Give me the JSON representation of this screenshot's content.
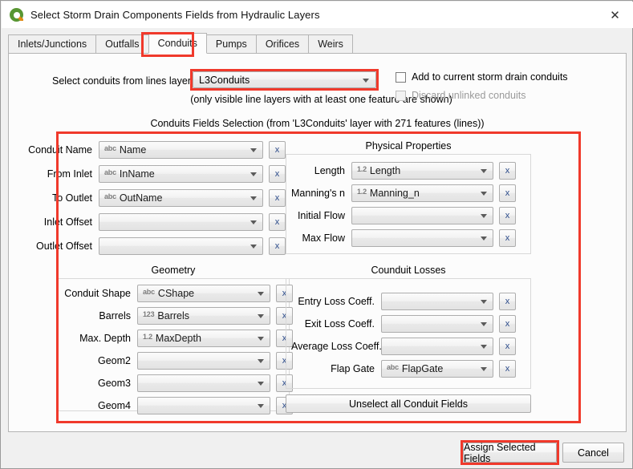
{
  "window": {
    "title": "Select Storm Drain Components Fields from Hydraulic Layers",
    "logo_icon": "qgis-logo-icon",
    "close_icon": "✕"
  },
  "tabs": [
    {
      "label": "Inlets/Junctions",
      "active": false
    },
    {
      "label": "Outfalls",
      "active": false
    },
    {
      "label": "Conduits",
      "active": true
    },
    {
      "label": "Pumps",
      "active": false
    },
    {
      "label": "Orifices",
      "active": false
    },
    {
      "label": "Weirs",
      "active": false
    }
  ],
  "layer_selector": {
    "label": "Select conduits from lines layer",
    "value": "L3Conduits",
    "hint": "(only visible line layers with at least one feature are shown)"
  },
  "options": [
    {
      "label": "Add to current storm drain conduits",
      "checked": false,
      "enabled": true
    },
    {
      "label": "Discard unlinked conduits",
      "checked": false,
      "enabled": false
    }
  ],
  "section_title": "Conduits Fields Selection (from 'L3Conduits' layer with 271 features (lines))",
  "clear_button_label": "x",
  "groups": {
    "main": {
      "caption": "",
      "rows": [
        {
          "label": "Conduit Name",
          "badge": "abc",
          "value": "Name"
        },
        {
          "label": "From Inlet",
          "badge": "abc",
          "value": "InName"
        },
        {
          "label": "To Outlet",
          "badge": "abc",
          "value": "OutName"
        },
        {
          "label": "Inlet Offset",
          "badge": "",
          "value": ""
        },
        {
          "label": "Outlet Offset",
          "badge": "",
          "value": ""
        }
      ]
    },
    "physical": {
      "caption": "Physical Properties",
      "rows": [
        {
          "label": "Length",
          "badge": "1.2",
          "value": "Length"
        },
        {
          "label": "Manning's n",
          "badge": "1.2",
          "value": "Manning_n"
        },
        {
          "label": "Initial Flow",
          "badge": "",
          "value": ""
        },
        {
          "label": "Max Flow",
          "badge": "",
          "value": ""
        }
      ]
    },
    "geometry": {
      "caption": "Geometry",
      "rows": [
        {
          "label": "Conduit Shape",
          "badge": "abc",
          "value": "CShape"
        },
        {
          "label": "Barrels",
          "badge": "123",
          "value": "Barrels"
        },
        {
          "label": "Max. Depth",
          "badge": "1.2",
          "value": "MaxDepth"
        },
        {
          "label": "Geom2",
          "badge": "",
          "value": ""
        },
        {
          "label": "Geom3",
          "badge": "",
          "value": ""
        },
        {
          "label": "Geom4",
          "badge": "",
          "value": ""
        }
      ]
    },
    "losses": {
      "caption": "Counduit Losses",
      "rows": [
        {
          "label": "Entry Loss Coeff.",
          "badge": "",
          "value": ""
        },
        {
          "label": "Exit Loss Coeff.",
          "badge": "",
          "value": ""
        },
        {
          "label": "Average Loss Coeff.",
          "badge": "",
          "value": ""
        },
        {
          "label": "Flap Gate",
          "badge": "abc",
          "value": "FlapGate"
        }
      ]
    }
  },
  "unselect_button": {
    "label": "Unselect all Conduit Fields"
  },
  "footer": {
    "assign_label": "Assign Selected Fields",
    "cancel_label": "Cancel"
  },
  "colors": {
    "highlight": "#f0392b",
    "panel_bg": "#fcfcfc",
    "dialog_bg": "#f0f0f0",
    "qgis_green": "#589632",
    "qgis_orange": "#e08a15"
  }
}
